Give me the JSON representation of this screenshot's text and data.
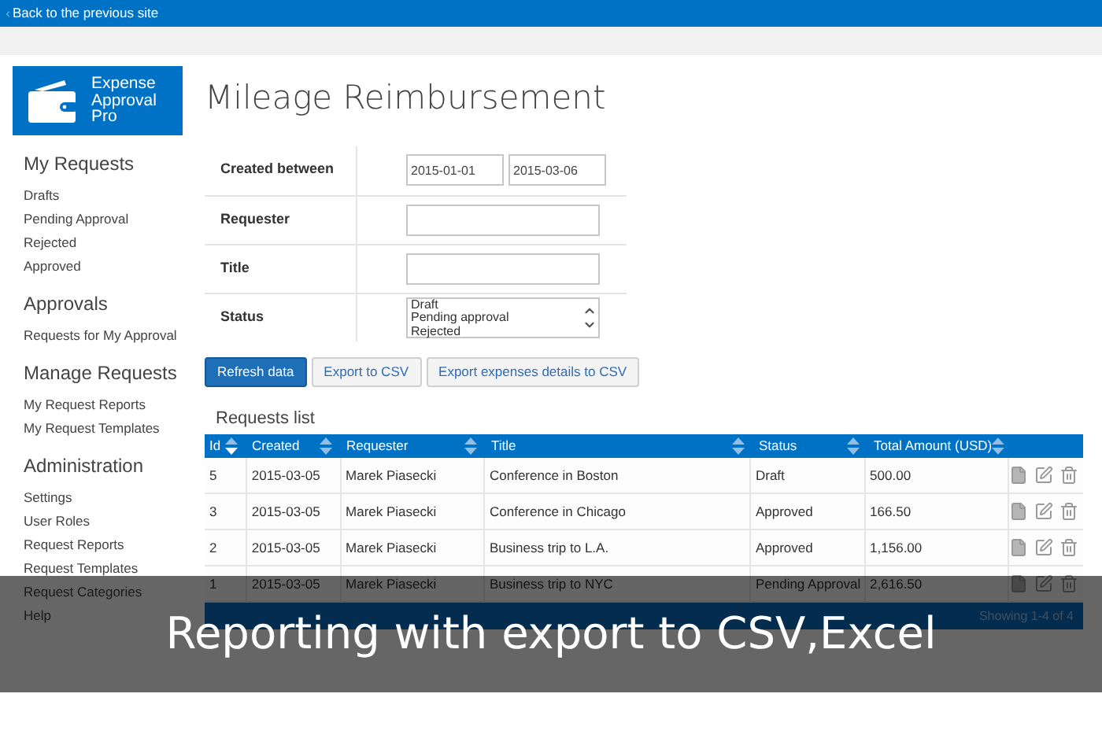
{
  "top_bar": {
    "link": "Back to the previous site"
  },
  "logo": {
    "text": [
      "Expense",
      "Approval",
      "Pro"
    ]
  },
  "sidebar": {
    "sections": [
      {
        "title": "My Requests",
        "items": [
          "Drafts",
          "Pending Approval",
          "Rejected",
          "Approved"
        ]
      },
      {
        "title": "Approvals",
        "items": [
          "Requests for My Approval"
        ]
      },
      {
        "title": "Manage Requests",
        "items": [
          "My Request Reports",
          "My Request Templates"
        ]
      },
      {
        "title": "Administration",
        "items": [
          "Settings",
          "User Roles",
          "Request Reports",
          "Request Templates",
          "Request Categories",
          "Help"
        ]
      }
    ]
  },
  "page_title": "Mileage Reimbursement",
  "filters": [
    {
      "kind": "date_range",
      "label": "Created between",
      "values": [
        "2015-01-01",
        "2015-03-06"
      ]
    },
    {
      "kind": "text",
      "label": "Requester"
    },
    {
      "kind": "text",
      "label": "Title"
    },
    {
      "kind": "listbox",
      "label": "Status",
      "options": [
        "Draft",
        "Pending approval",
        "Rejected"
      ]
    }
  ],
  "buttons": [
    {
      "label": "Refresh data",
      "primary": true
    },
    {
      "label": "Export to CSV",
      "primary": false
    },
    {
      "label": "Export expenses details to CSV",
      "primary": false
    }
  ],
  "table": {
    "title": "Requests list",
    "columns": [
      {
        "label": "Id",
        "sorted": true
      },
      {
        "label": "Created",
        "sorted": false
      },
      {
        "label": "Requester",
        "sorted": false
      },
      {
        "label": "Title",
        "sorted": false
      },
      {
        "label": "Status",
        "sorted": false
      },
      {
        "label": "Total Amount (USD)",
        "sorted": false
      }
    ],
    "rows": [
      [
        "5",
        "2015-03-05",
        "Marek Piasecki",
        "Conference in Boston",
        "Draft",
        "500.00"
      ],
      [
        "3",
        "2015-03-05",
        "Marek Piasecki",
        "Conference in Chicago",
        "Approved",
        "166.50"
      ],
      [
        "2",
        "2015-03-05",
        "Marek Piasecki",
        "Business trip to L.A.",
        "Approved",
        "1,156.00"
      ],
      [
        "1",
        "2015-03-05",
        "Marek Piasecki",
        "Business trip to NYC",
        "Pending Approval",
        "2,616.50"
      ]
    ]
  },
  "pager": {
    "summary": "Showing 1-4 of 4"
  },
  "caption": "Reporting with export to CSV,Excel"
}
